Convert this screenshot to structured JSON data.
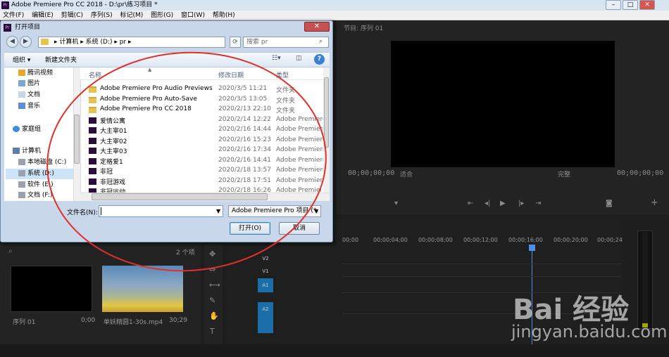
{
  "app": {
    "title": "Adobe Premiere Pro CC 2018 - D:\\pr\\练习项目 *",
    "logo": "Pr",
    "window_buttons": [
      "–",
      "□",
      "✕"
    ]
  },
  "menu": [
    "文件(F)",
    "编辑(E)",
    "剪辑(C)",
    "序列(S)",
    "标记(M)",
    "图形(G)",
    "窗口(W)",
    "帮助(H)"
  ],
  "program_monitor": {
    "title": "节目: 序列 01",
    "timecode_left": "00;00;00;00",
    "timecode_right": "00;00;00;00",
    "fit_select": "适合",
    "quality_select": "完整"
  },
  "timeline": {
    "ruler_ticks": [
      "00;00",
      "00;00;04;00",
      "00;00;08;00",
      "00;00;12;00",
      "00;00;16;00",
      "00;00;20;00",
      "00;00;24"
    ],
    "tracks": [
      "V2",
      "V1",
      "A1",
      "A2"
    ]
  },
  "project_panel": {
    "count_label": "2 个项",
    "item1_name": "序列 01",
    "item1_duration": "0;00",
    "item2_name": "单妖精圆1-30s.mp4",
    "item2_duration": "30;29"
  },
  "dialog": {
    "title": "打开项目",
    "icon": "Pr",
    "close": "✕",
    "breadcrumb": "▸ 计算机 ▸ 系统 (D:) ▸ pr ▸",
    "search_placeholder": "搜索 pr",
    "toolbar": {
      "organize": "组织 ▾",
      "new_folder": "新建文件夹",
      "help": "?"
    },
    "nav_items": [
      {
        "label": "腾讯视频",
        "icon": "tencent-video-icon"
      },
      {
        "label": "图片",
        "icon": "pictures-icon"
      },
      {
        "label": "文档",
        "icon": "documents-icon"
      },
      {
        "label": "音乐",
        "icon": "music-icon"
      },
      {
        "label": "家庭组",
        "icon": "homegroup-icon"
      },
      {
        "label": "计算机",
        "icon": "computer-icon"
      },
      {
        "label": "本地磁盘 (C:)",
        "icon": "drive-icon"
      },
      {
        "label": "系统 (D:)",
        "icon": "drive-icon"
      },
      {
        "label": "软件 (E:)",
        "icon": "drive-icon"
      },
      {
        "label": "文档 (F:)",
        "icon": "drive-icon"
      }
    ],
    "columns": [
      "名称",
      "修改日期",
      "类型"
    ],
    "files": [
      {
        "name": "Adobe Premiere Pro Audio Previews",
        "date": "2020/3/5 11:21",
        "type": "文件夹",
        "kind": "folder"
      },
      {
        "name": "Adobe Premiere Pro Auto-Save",
        "date": "2020/3/5 13:05",
        "type": "文件夹",
        "kind": "folder"
      },
      {
        "name": "Adobe Premiere Pro CC 2018",
        "date": "2020/2/13 22:10",
        "type": "文件夹",
        "kind": "folder"
      },
      {
        "name": "爱情公寓",
        "date": "2020/2/14 12:22",
        "type": "Adobe Premiere",
        "kind": "pr"
      },
      {
        "name": "大主宰01",
        "date": "2020/2/16 14:44",
        "type": "Adobe Premiere",
        "kind": "pr"
      },
      {
        "name": "大主宰02",
        "date": "2020/2/16 15:23",
        "type": "Adobe Premiere",
        "kind": "pr"
      },
      {
        "name": "大主宰03",
        "date": "2020/2/16 17:34",
        "type": "Adobe Premiere",
        "kind": "pr"
      },
      {
        "name": "定格爱1",
        "date": "2020/2/16 14:41",
        "type": "Adobe Premiere",
        "kind": "pr"
      },
      {
        "name": "非冠",
        "date": "2020/2/18 13:57",
        "type": "Adobe Premiere",
        "kind": "pr"
      },
      {
        "name": "非冠游戏",
        "date": "2020/2/18 17:51",
        "type": "Adobe Premiere",
        "kind": "pr"
      },
      {
        "name": "非冠运动",
        "date": "2020/2/18 16:26",
        "type": "Adobe Premiere",
        "kind": "pr"
      }
    ],
    "filename_label": "文件名(N):",
    "filename_value": "",
    "filetype_value": "Adobe Premiere Pro 项目 (*.",
    "open_button": "打开(O)",
    "cancel_button": "取消"
  },
  "watermark": {
    "logo_text": "Bai 经验",
    "url": "jingyan.baidu.com"
  },
  "colors": {
    "accent_blue": "#4a8fe8",
    "annotation_red": "#e0302a",
    "folder_yellow": "#e6c34e",
    "pr_purple": "#2b0c3e"
  }
}
